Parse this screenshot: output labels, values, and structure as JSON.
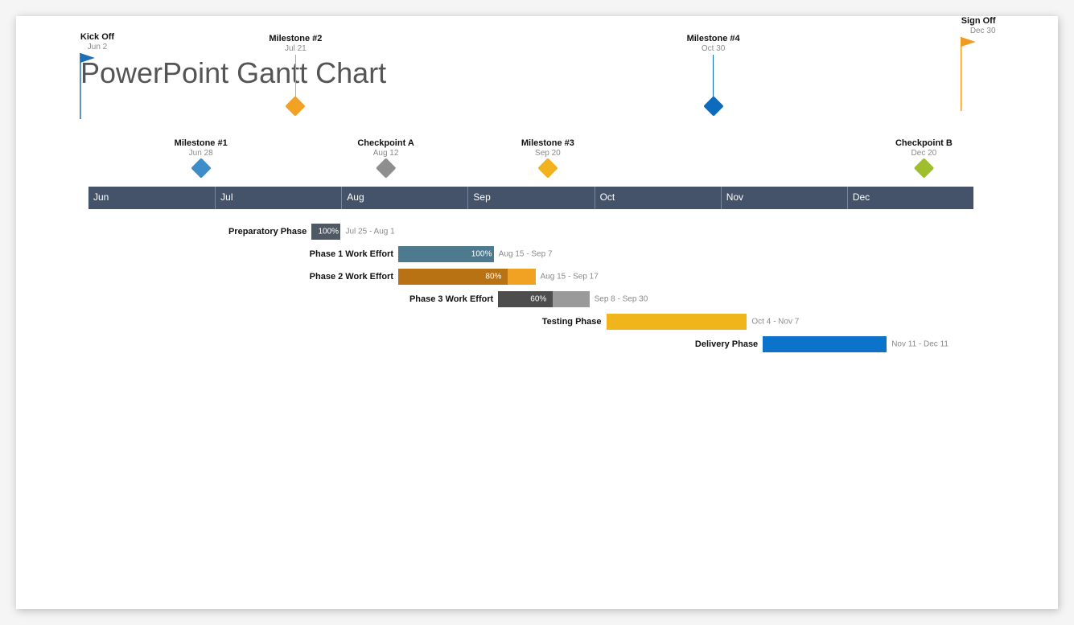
{
  "title": "PowerPoint Gantt Chart",
  "chart_data": {
    "type": "gantt",
    "timeline": {
      "start": "Jun 1",
      "end": "Dec 31",
      "months": [
        "Jun",
        "Jul",
        "Aug",
        "Sep",
        "Oct",
        "Nov",
        "Dec"
      ]
    },
    "milestones": [
      {
        "name": "Kick Off",
        "date": "Jun 2",
        "pos_pct": 1.0,
        "style": "flag",
        "color": "#1f6fb3",
        "row": "top",
        "stem": 70
      },
      {
        "name": "Milestone #1",
        "date": "Jun 28",
        "pos_pct": 12.7,
        "style": "diamond",
        "color": "#3e8dc9",
        "row": "mid",
        "stem": 0
      },
      {
        "name": "Milestone #2",
        "date": "Jul 21",
        "pos_pct": 23.4,
        "style": "diamond",
        "color": "#f2a223",
        "row": "top",
        "stem": 55
      },
      {
        "name": "Checkpoint A",
        "date": "Aug 12",
        "pos_pct": 33.6,
        "style": "diamond",
        "color": "#8e8e8e",
        "row": "mid",
        "stem": 0
      },
      {
        "name": "Milestone #3",
        "date": "Sep 20",
        "pos_pct": 51.9,
        "style": "diamond",
        "color": "#f2b21d",
        "row": "mid",
        "stem": 0
      },
      {
        "name": "Milestone #4",
        "date": "Oct 30",
        "pos_pct": 70.6,
        "style": "diamond",
        "color": "#0d6bbe",
        "row": "top",
        "stem": 55
      },
      {
        "name": "Checkpoint B",
        "date": "Dec 20",
        "pos_pct": 94.4,
        "style": "diamond",
        "color": "#9fbd2c",
        "row": "mid",
        "stem": 0
      },
      {
        "name": "Sign Off",
        "date": "Dec 30",
        "pos_pct": 99.0,
        "style": "flag",
        "color": "#f29a1f",
        "row": "top",
        "stem": 80
      }
    ],
    "tasks": [
      {
        "name": "Preparatory Phase",
        "range": "Jul 25 - Aug 1",
        "start_pct": 25.2,
        "end_pct": 28.5,
        "pct_complete": 100,
        "bar_color": "#6c98ab",
        "fill_color": "#4f5863"
      },
      {
        "name": "Phase 1 Work Effort",
        "range": "Aug 15 - Sep 7",
        "start_pct": 35.0,
        "end_pct": 45.8,
        "pct_complete": 100,
        "bar_color": "#6c98ab",
        "fill_color": "#4d7a8f"
      },
      {
        "name": "Phase 2 Work Effort",
        "range": "Aug 15 - Sep 17",
        "start_pct": 35.0,
        "end_pct": 50.5,
        "pct_complete": 80,
        "bar_color": "#f2a223",
        "fill_color": "#b87214"
      },
      {
        "name": "Phase 3 Work Effort",
        "range": "Sep 8 - Sep 30",
        "start_pct": 46.3,
        "end_pct": 56.6,
        "pct_complete": 60,
        "bar_color": "#9a9a9a",
        "fill_color": "#4d4d4d"
      },
      {
        "name": "Testing Phase",
        "range": "Oct 4 - Nov 7",
        "start_pct": 58.5,
        "end_pct": 74.4,
        "pct_complete": null,
        "bar_color": "#f0b51a",
        "fill_color": null
      },
      {
        "name": "Delivery Phase",
        "range": "Nov 11 - Dec 11",
        "start_pct": 76.2,
        "end_pct": 90.2,
        "pct_complete": null,
        "bar_color": "#0d72c9",
        "fill_color": null
      }
    ]
  }
}
